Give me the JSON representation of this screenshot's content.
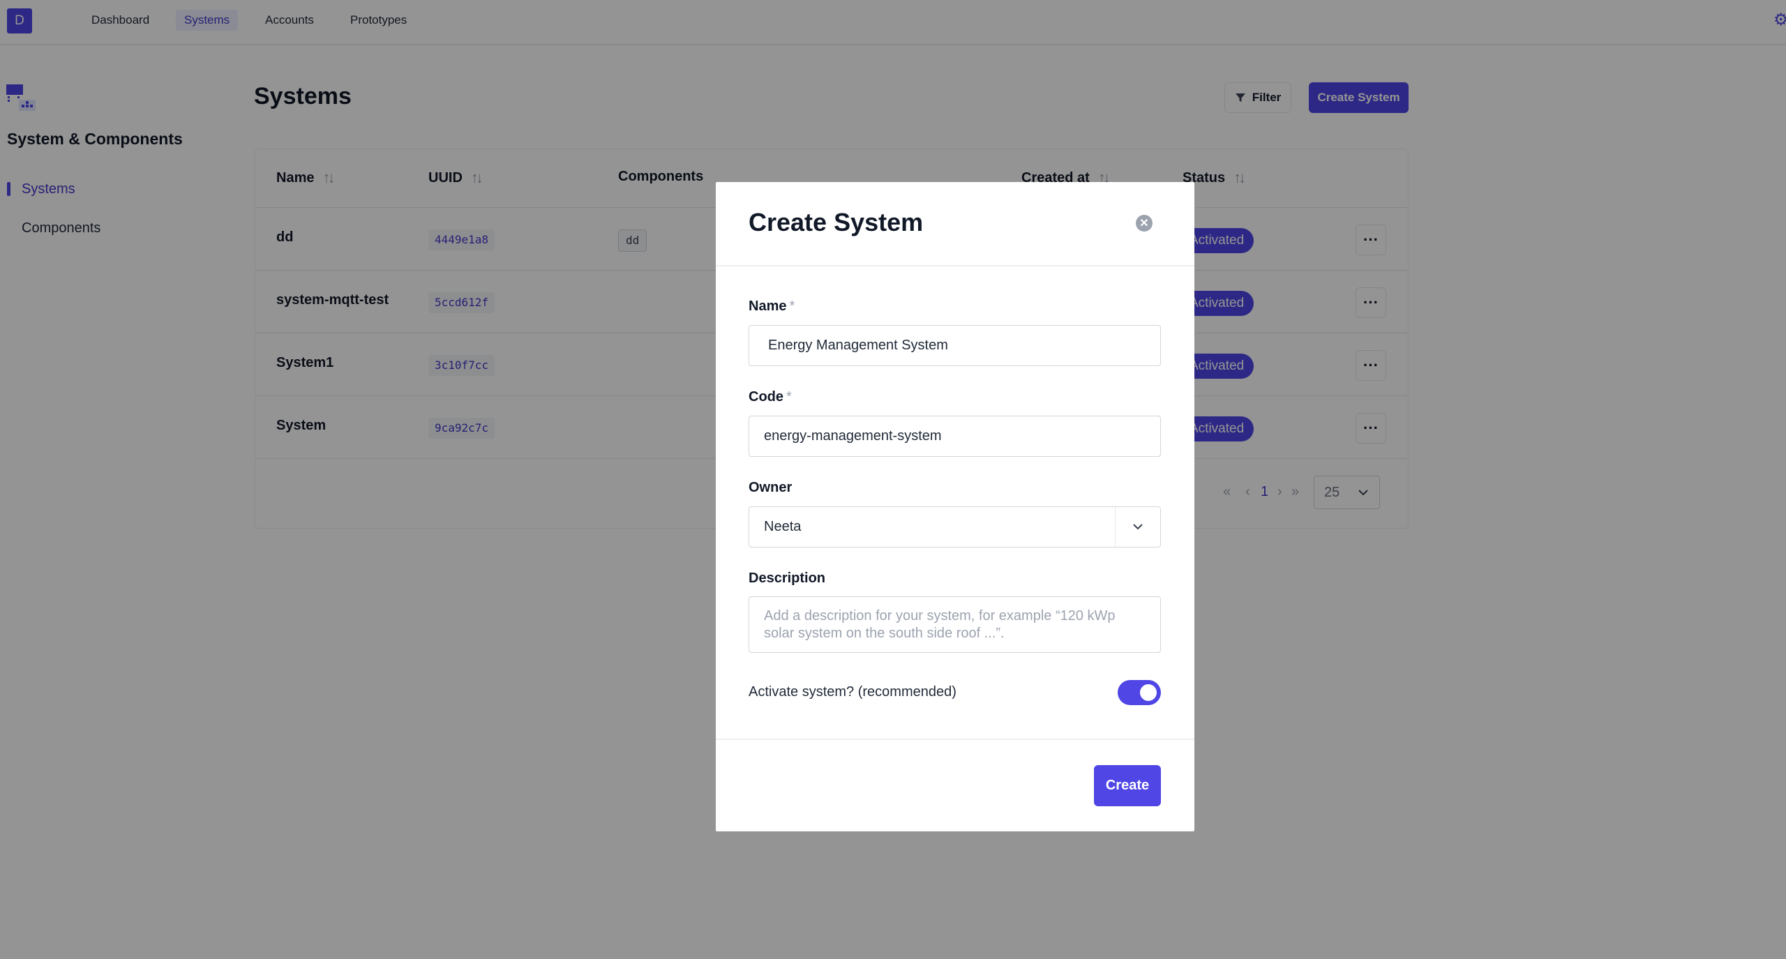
{
  "logo": "D",
  "nav": [
    {
      "label": "Dashboard"
    },
    {
      "label": "Systems"
    },
    {
      "label": "Accounts"
    },
    {
      "label": "Prototypes"
    }
  ],
  "sidebar": {
    "title": "System & Components",
    "items": [
      {
        "label": "Systems"
      },
      {
        "label": "Components"
      }
    ]
  },
  "main": {
    "title": "Systems",
    "filter_label": "Filter",
    "create_label": "Create System"
  },
  "table": {
    "columns": [
      "Name",
      "UUID",
      "Components",
      "Created at",
      "Status"
    ],
    "rows": [
      {
        "name": "dd",
        "uuid": "4449e1a8",
        "component": "dd",
        "status": "Activated"
      },
      {
        "name": "system-mqtt-test",
        "uuid": "5ccd612f",
        "component": "",
        "status": "Activated"
      },
      {
        "name": "System1",
        "uuid": "3c10f7cc",
        "component": "",
        "status": "Activated"
      },
      {
        "name": "System",
        "uuid": "9ca92c7c",
        "component": "",
        "status": "Activated"
      }
    ],
    "more_glyph": "···"
  },
  "pagination": {
    "first": "«",
    "prev": "‹",
    "current_page": "1",
    "next": "›",
    "last": "»",
    "page_size": "25"
  },
  "modal": {
    "title": "Create System",
    "required_mark": "*",
    "name_label": "Name",
    "name_value": "Energy Management System",
    "code_label": "Code",
    "code_value": "energy-management-system",
    "owner_label": "Owner",
    "owner_value": "Neeta",
    "description_label": "Description",
    "description_placeholder": "Add a description for your system, for example “120 kWp solar system on the south side roof ...”.",
    "activate_label": "Activate system? (recommended)",
    "activate_on": true,
    "submit_label": "Create"
  },
  "colors": {
    "accent": "#4f46e5",
    "overlay": "rgba(0,0,0,0.42)"
  },
  "icons": [
    "settings-icon",
    "systems-components-icon",
    "sort-icon",
    "filter-icon",
    "close-circle-icon",
    "chevron-down-icon",
    "more-icon"
  ]
}
